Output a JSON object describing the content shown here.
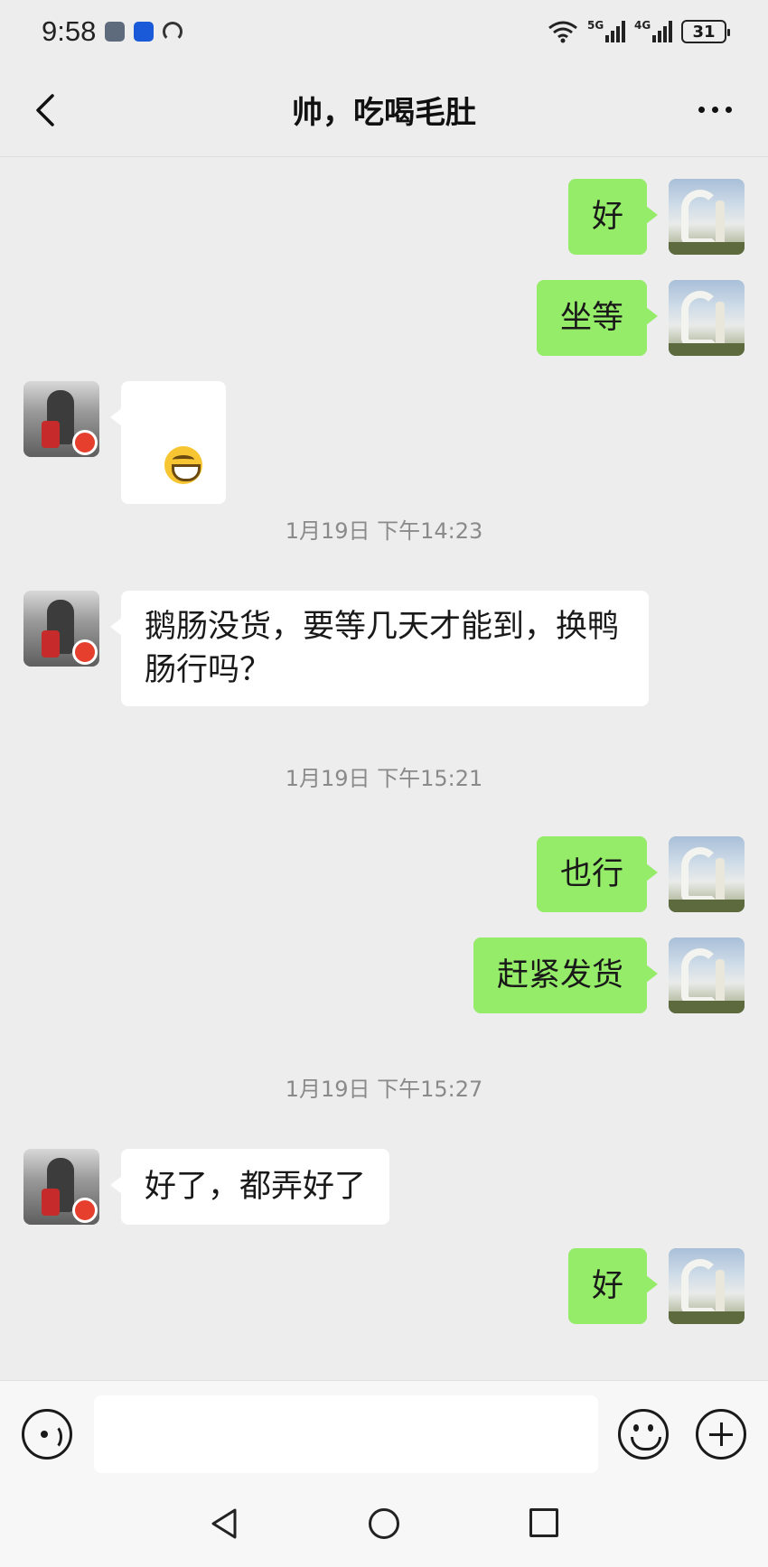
{
  "status_bar": {
    "time": "9:58",
    "network_5g": "5G",
    "network_4g": "4G",
    "battery": "31"
  },
  "header": {
    "title": "帅，吃喝毛肚",
    "back_icon": "chevron-left-icon",
    "more_icon": "more-dots-icon"
  },
  "messages": [
    {
      "sender": "me",
      "type": "text",
      "text": "好"
    },
    {
      "sender": "me",
      "type": "text",
      "text": "坐等"
    },
    {
      "sender": "other",
      "type": "emoji",
      "emoji": "grin-emoji"
    },
    {
      "type": "timestamp",
      "text": "1月19日 下午14:23"
    },
    {
      "sender": "other",
      "type": "text",
      "text": "鹅肠没货，要等几天才能到，换鸭\n肠行吗？"
    },
    {
      "type": "timestamp",
      "text": "1月19日 下午15:21"
    },
    {
      "sender": "me",
      "type": "text",
      "text": "也行"
    },
    {
      "sender": "me",
      "type": "text",
      "text": "赶紧发货"
    },
    {
      "type": "timestamp",
      "text": "1月19日 下午15:27"
    },
    {
      "sender": "other",
      "type": "text",
      "text": "好了，都弄好了"
    },
    {
      "sender": "me",
      "type": "text",
      "text": "好"
    }
  ],
  "input_bar": {
    "voice_icon": "voice-icon",
    "input_value": "",
    "emoji_icon": "emoji-icon",
    "plus_icon": "plus-icon"
  },
  "colors": {
    "my_bubble": "#95ec69",
    "other_bubble": "#ffffff",
    "background": "#ededed"
  }
}
